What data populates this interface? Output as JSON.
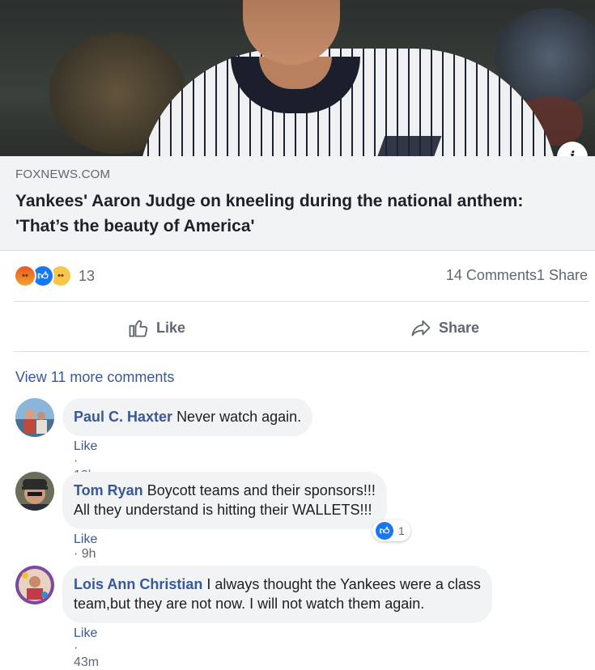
{
  "post": {
    "source": "FOXNEWS.COM",
    "headline": "Yankees' Aaron Judge on kneeling during the national anthem: 'That’s the beauty of America'"
  },
  "reactions": {
    "types": [
      "angry",
      "like",
      "sad"
    ],
    "count": "13",
    "comments_shares": "14 Comments1 Share"
  },
  "actions": {
    "like_label": "Like",
    "share_label": "Share"
  },
  "comments_section": {
    "view_more": "View 11 more comments",
    "comments": [
      {
        "author": "Paul C. Haxter",
        "text_lines": [
          "Never watch again."
        ],
        "like_label": "Like",
        "time": "10h"
      },
      {
        "author": "Tom Ryan",
        "text_lines": [
          "Boycott teams and their sponsors!!!",
          "All they understand is hitting their WALLETS!!!"
        ],
        "like_label": "Like",
        "time": "9h",
        "reaction_count": "1"
      },
      {
        "author": "Lois Ann Christian",
        "text_lines": [
          "I always thought the Yankees were a class",
          "team,but they are not now. I will not watch them again."
        ],
        "like_label": "Like",
        "time": "43m"
      }
    ]
  },
  "colors": {
    "link_blue": "#385898",
    "like_blue": "#1877f2",
    "secondary_text": "#606770",
    "bubble_bg": "#f2f3f5"
  }
}
